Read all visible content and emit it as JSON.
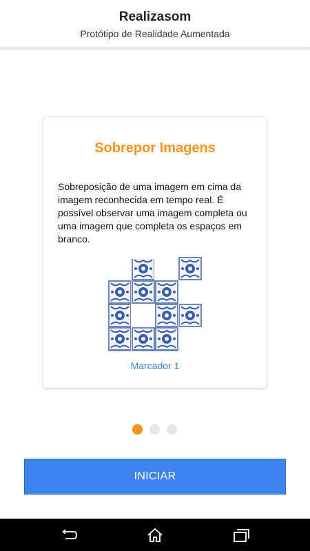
{
  "header": {
    "title": "Realizasom",
    "subtitle": "Protótipo de Realidade Aumentada"
  },
  "card": {
    "title": "Sobrepor Imagens",
    "description": "Sobreposição de uma imagem em cima da imagem reconhecida em tempo real. É possível observar uma imagem completa ou uma imagem que completa os espaços em branco.",
    "marker_label": "Marcador 1"
  },
  "pager": {
    "count": 3,
    "active_index": 0
  },
  "start_button": {
    "label": "INICIAR"
  },
  "navbar": {
    "icons": [
      "back-icon",
      "home-icon",
      "recent-apps-icon"
    ]
  },
  "colors": {
    "accent": "#f7941d",
    "button": "#3e83f0",
    "link": "#3a86d6",
    "dot_inactive": "#e6e6e6"
  }
}
